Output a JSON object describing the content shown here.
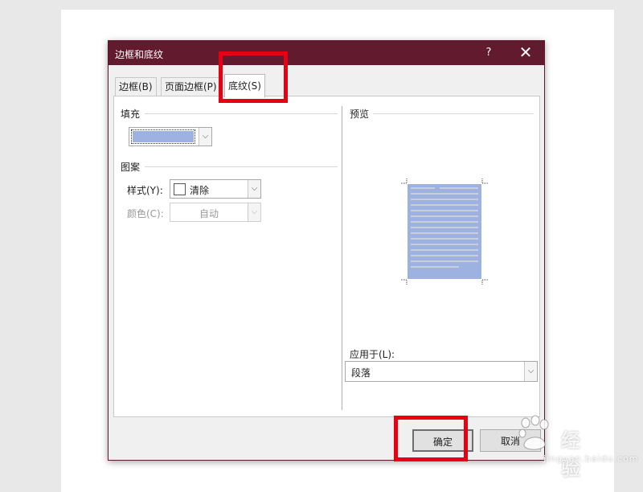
{
  "dialog": {
    "title": "边框和底纹",
    "help_glyph": "?",
    "close_glyph": "✕",
    "title_bar_color": "#611a2e"
  },
  "tabs": [
    {
      "label": "边框(B)",
      "active": false
    },
    {
      "label": "页面边框(P)",
      "active": false
    },
    {
      "label": "底纹(S)",
      "active": true
    }
  ],
  "fill": {
    "group_label": "填充",
    "selected_color": "#9db2e1",
    "arrow_glyph": "⌵"
  },
  "pattern": {
    "group_label": "图案",
    "style_label": "样式(Y):",
    "style_value": "清除",
    "color_label": "颜色(C):",
    "color_value": "自动"
  },
  "preview": {
    "group_label": "预览"
  },
  "apply_to": {
    "label": "应用于(L):",
    "value": "段落"
  },
  "buttons": {
    "ok": "确定",
    "cancel": "取消"
  },
  "watermark": {
    "brand": "经验",
    "url": "jingyan.baidu.com"
  },
  "highlight_color": "#e60012"
}
